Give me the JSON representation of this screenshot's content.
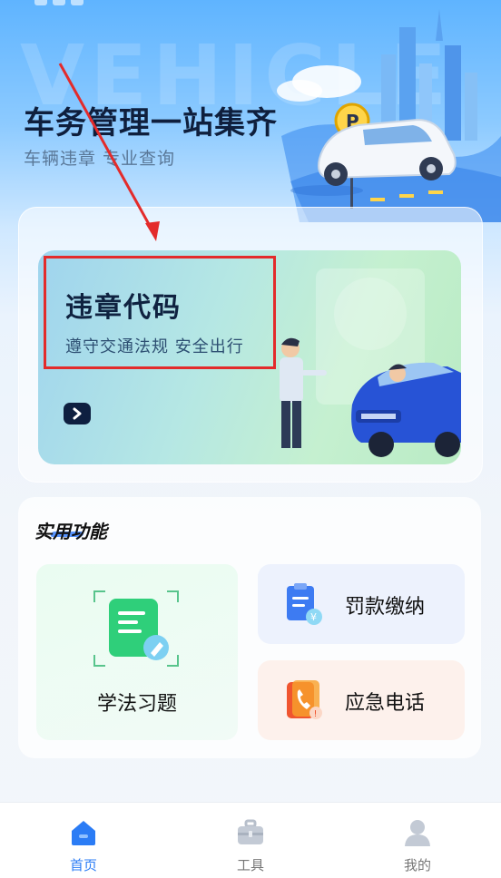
{
  "hero": {
    "bg_word": "VEHICLE",
    "title": "车务管理一站集齐",
    "subtitle": "车辆违章 专业查询"
  },
  "banner": {
    "title": "违章代码",
    "subtitle": "遵守交通法规 安全出行"
  },
  "features": {
    "title": "实用功能",
    "items": [
      {
        "label": "学法习题",
        "icon": "notes-edit-icon"
      },
      {
        "label": "罚款缴纳",
        "icon": "bill-yuan-icon"
      },
      {
        "label": "应急电话",
        "icon": "phone-call-icon"
      }
    ]
  },
  "tabbar": {
    "items": [
      {
        "label": "首页",
        "icon": "home-icon",
        "active": true
      },
      {
        "label": "工具",
        "icon": "toolbox-icon",
        "active": false
      },
      {
        "label": "我的",
        "icon": "user-icon",
        "active": false
      }
    ]
  },
  "colors": {
    "accent": "#2b7cf5",
    "annotation": "#e32b2b",
    "dark_text": "#0f1f3d"
  }
}
